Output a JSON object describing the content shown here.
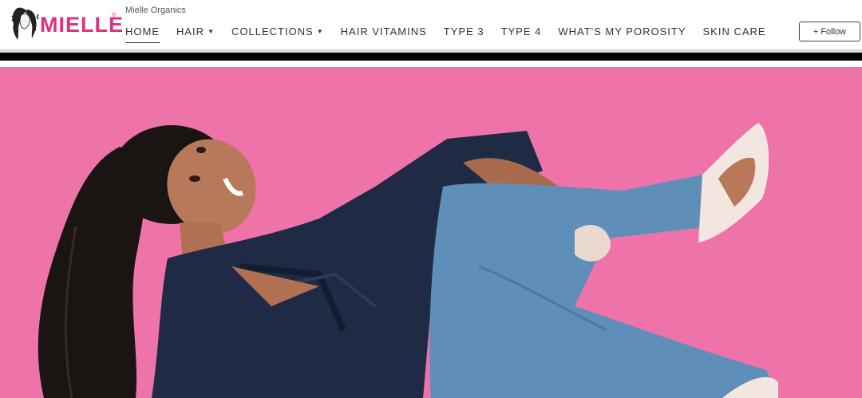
{
  "logo": {
    "text": "MIELLE",
    "registered": "®"
  },
  "brand_name": "Mielle Organics",
  "nav": [
    {
      "label": "HOME",
      "active": true,
      "dropdown": false
    },
    {
      "label": "HAIR",
      "active": false,
      "dropdown": true
    },
    {
      "label": "COLLECTIONS",
      "active": false,
      "dropdown": true
    },
    {
      "label": "HAIR VITAMINS",
      "active": false,
      "dropdown": false
    },
    {
      "label": "TYPE 3",
      "active": false,
      "dropdown": false
    },
    {
      "label": "TYPE 4",
      "active": false,
      "dropdown": false
    },
    {
      "label": "WHAT'S MY POROSITY",
      "active": false,
      "dropdown": false
    },
    {
      "label": "SKIN CARE",
      "active": false,
      "dropdown": false
    }
  ],
  "follow_label": "+ Follow",
  "colors": {
    "brand_pink": "#e0317e",
    "hero_background": "#ec6fa6",
    "jeans": "#5f8fb8",
    "blouse": "#1f2a44"
  },
  "icons": {
    "dropdown": "caret-down-icon",
    "logo_face": "curly-hair-face-logo"
  }
}
